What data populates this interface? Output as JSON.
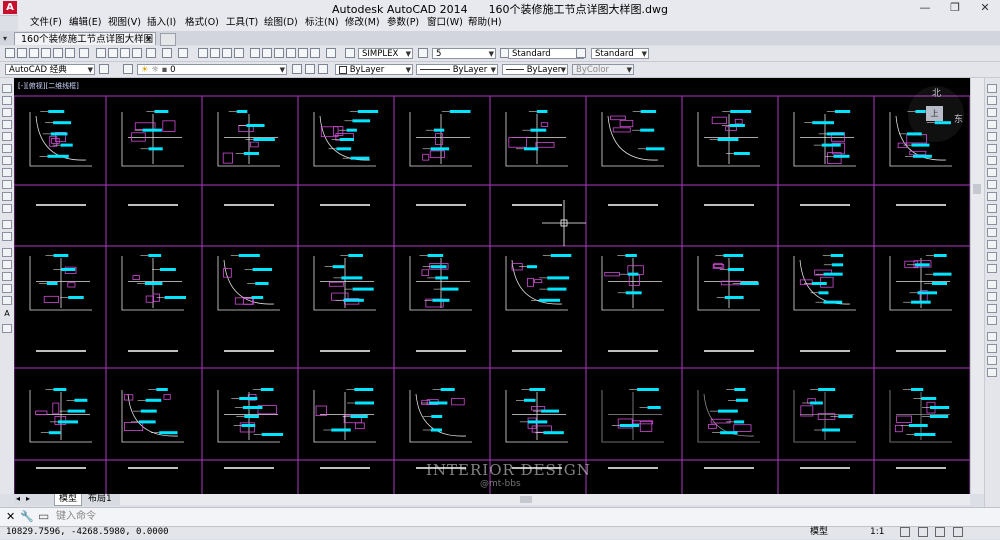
{
  "window": {
    "app_name": "Autodesk AutoCAD 2014",
    "file_name": "160个装修施工节点详图大样图.dwg",
    "app_icon_letter": "A",
    "min": "—",
    "max": "❐",
    "close": "✕"
  },
  "menu": [
    "文件(F)",
    "编辑(E)",
    "视图(V)",
    "插入(I)",
    "格式(O)",
    "工具(T)",
    "绘图(D)",
    "标注(N)",
    "修改(M)",
    "参数(P)",
    "窗口(W)",
    "帮助(H)"
  ],
  "doc_tab": "160个装修施工节点详图大样图*",
  "toolbar1": {
    "text_style": "SIMPLEX",
    "dim_value": "5",
    "dim_style": "Standard",
    "table_style": "Standard"
  },
  "toolbar2": {
    "workspace": "AutoCAD 经典",
    "layer": "0",
    "color": "ByLayer",
    "linetype": "ByLayer",
    "lineweight": "ByLayer",
    "plotstyle": "ByColor"
  },
  "viewport_label": "[-][俯视][二维线框]",
  "compass": {
    "north": "北",
    "east": "东",
    "top": "上"
  },
  "watermark": {
    "main": "INTERIOR DESIGN",
    "sub": "@mt-bbs"
  },
  "layout_tabs": [
    "模型",
    "布局1"
  ],
  "command": {
    "placeholder": "键入命令"
  },
  "status": {
    "coords": "10829.7596,  -4268.5980, 0.0000",
    "model": "模型",
    "scale": "1:1"
  },
  "accent_colors": {
    "cyan": "#00e5ff",
    "magenta": "#d14bd6",
    "grid": "#b037c4",
    "background": "#000000"
  }
}
